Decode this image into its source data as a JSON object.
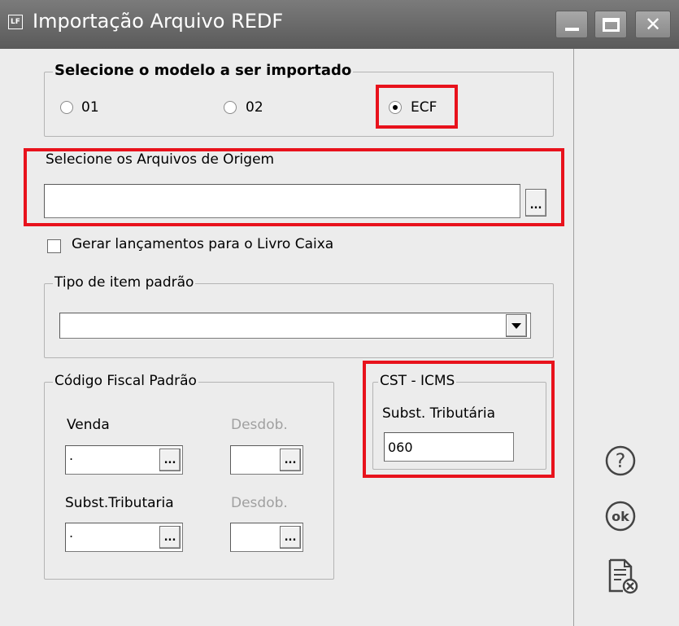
{
  "window": {
    "title": "Importação Arquivo REDF",
    "app_icon": "LF"
  },
  "model_group": {
    "legend": "Selecione o modelo a ser importado",
    "options": [
      {
        "label": "01",
        "checked": false
      },
      {
        "label": "02",
        "checked": false
      },
      {
        "label": "ECF",
        "checked": true
      }
    ]
  },
  "source_files": {
    "label": "Selecione os Arquivos de Origem",
    "value": "",
    "browse_label": "..."
  },
  "livro_caixa": {
    "label": "Gerar lançamentos para o Livro Caixa",
    "checked": false
  },
  "item_type": {
    "legend": "Tipo de item padrão",
    "selected": ""
  },
  "fiscal_code": {
    "legend": "Código Fiscal Padrão",
    "venda_label": "Venda",
    "venda_value": ".",
    "desdob_label": "Desdob.",
    "subst_label": "Subst.Tributaria",
    "subst_value": ".",
    "desdob2_label": "Desdob.",
    "browse_label": "..."
  },
  "cst_icms": {
    "legend": "CST - ICMS",
    "field_label": "Subst. Tributária",
    "value": "060"
  },
  "side_buttons": {
    "help_glyph": "?",
    "ok_label": "ok"
  },
  "colors": {
    "highlight": "#e8121c",
    "titlebar": "#6a6a6a"
  }
}
